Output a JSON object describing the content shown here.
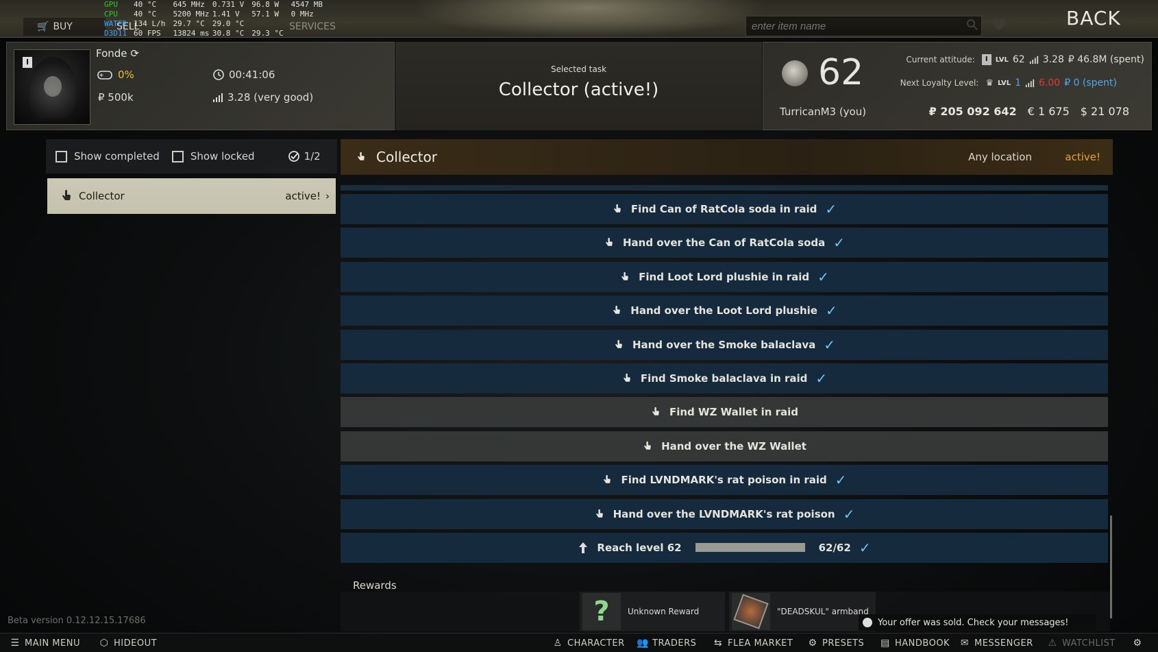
{
  "topbar": {
    "buy": "BUY",
    "sell": "SELL",
    "services": "SERVICES",
    "search_placeholder": "enter item name",
    "back": "BACK"
  },
  "hw_overlay": {
    "rows": [
      {
        "label": "GPU",
        "c1": "40 °C",
        "c2": "645 MHz",
        "c3": "0.731 V",
        "c4": "96.8 W",
        "c5": "4547 MB"
      },
      {
        "label": "CPU",
        "c1": "40 °C",
        "c2": "5200 MHz",
        "c3": "1.41 V",
        "c4": "57.1 W",
        "c5": "0 MHz"
      },
      {
        "label": "WATER",
        "c1": "134 L/h",
        "c2": "29.7 °C",
        "c3": "29.0 °C",
        "c4": "",
        "c5": ""
      },
      {
        "label": "D3D11",
        "c1": "60 FPS",
        "c2": "13824 ms",
        "c3": "30.8 °C",
        "c4": "29.3 °C",
        "c5": ""
      }
    ]
  },
  "profile": {
    "rank": "I",
    "nickname": "Fonde",
    "pmc_percent": "0%",
    "time": "00:41:06",
    "money": "₽ 500k",
    "rating": "3.28 (very good)"
  },
  "task_header": {
    "label": "Selected task",
    "title": "Collector (active!)"
  },
  "trader": {
    "level": "62",
    "name": "TurricanM3 (you)",
    "current_label": "Current attitude:",
    "current_rank": "I",
    "current_lvl_prefix": "LVL",
    "current_lvl": "62",
    "current_rep": "3.28",
    "current_spent": "₽ 46.8M (spent)",
    "next_label": "Next Loyalty Level:",
    "next_lvl_prefix": "LVL",
    "next_lvl": "1",
    "next_rep": "6.00",
    "next_spent": "₽ 0 (spent)",
    "rub": "₽ 205 092 642",
    "eur": "€ 1 675",
    "usd": "$ 21 078"
  },
  "filters": {
    "show_completed": "Show completed",
    "show_locked": "Show locked",
    "count": "1/2"
  },
  "task_list": [
    {
      "name": "Collector",
      "status": "active!"
    }
  ],
  "detail": {
    "name": "Collector",
    "location": "Any location",
    "status": "active!"
  },
  "objectives": [
    {
      "text": "Find Can of RatCola soda in raid",
      "done": true
    },
    {
      "text": "Hand over the Can of RatCola soda",
      "done": true
    },
    {
      "text": "Find Loot Lord plushie in raid",
      "done": true
    },
    {
      "text": "Hand over the Loot Lord plushie",
      "done": true
    },
    {
      "text": "Hand over the Smoke balaclava",
      "done": true
    },
    {
      "text": "Find Smoke balaclava in raid",
      "done": true
    },
    {
      "text": "Find WZ Wallet in raid",
      "done": false
    },
    {
      "text": "Hand over the WZ Wallet",
      "done": false
    },
    {
      "text": "Find LVNDMARK's rat poison in raid",
      "done": true
    },
    {
      "text": "Hand over the LVNDMARK's rat poison",
      "done": true
    }
  ],
  "level_objective": {
    "text": "Reach level 62",
    "progress": "62/62",
    "progress_fraction": 1.0
  },
  "rewards": {
    "label": "Rewards",
    "items": [
      {
        "name": "Unknown Reward"
      },
      {
        "name": "\"DEADSKUL\" armband"
      }
    ]
  },
  "beta": "Beta version 0.12.12.15.17686",
  "notification": "Your offer was sold. Check your messages!",
  "bottombar": {
    "main_menu": "MAIN MENU",
    "hideout": "HIDEOUT",
    "character": "CHARACTER",
    "traders": "TRADERS",
    "flea_market": "FLEA MARKET",
    "presets": "PRESETS",
    "handbook": "HANDBOOK",
    "messenger": "MESSENGER",
    "watchlist": "WATCHLIST"
  },
  "colors": {
    "active": "#e8a22c",
    "check": "#6dc6f5",
    "objective_done_bg": "#152a3c",
    "objective_pending_bg": "#353737"
  }
}
